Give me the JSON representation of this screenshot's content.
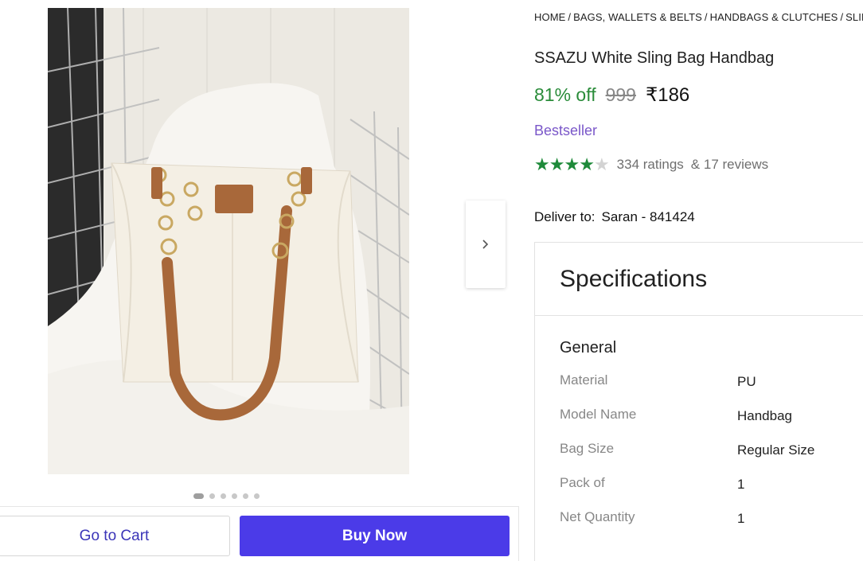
{
  "breadcrumb": [
    "HOME",
    "BAGS, WALLETS & BELTS",
    "HANDBAGS & CLUTCHES",
    "SLING"
  ],
  "breadcrumb_separator": "/",
  "product": {
    "title": "SSAZU White Sling Bag Handbag",
    "discount": "81% off",
    "mrp": "999",
    "price": "₹186",
    "badge": "Bestseller",
    "rating_stars": 4,
    "ratings_text": "334 ratings",
    "reviews_text": "& 17 reviews"
  },
  "delivery": {
    "label": "Deliver to:",
    "location": "Saran - 841424"
  },
  "gallery": {
    "image_count": 6,
    "active_index": 0,
    "next_icon": "chevron-right-icon"
  },
  "actions": {
    "cart_label": "Go to Cart",
    "buy_label": "Buy Now"
  },
  "specifications": {
    "heading": "Specifications",
    "group": "General",
    "rows": [
      {
        "key": "Material",
        "value": "PU"
      },
      {
        "key": "Model Name",
        "value": "Handbag"
      },
      {
        "key": "Bag Size",
        "value": "Regular Size"
      },
      {
        "key": "Pack of",
        "value": "1"
      },
      {
        "key": "Net Quantity",
        "value": "1"
      }
    ]
  },
  "colors": {
    "discount_green": "#2a8c3a",
    "star_green": "#1e8a3a",
    "bestseller_purple": "#7a57c9",
    "buy_button": "#4b3be8",
    "cart_text": "#3b35b8"
  }
}
